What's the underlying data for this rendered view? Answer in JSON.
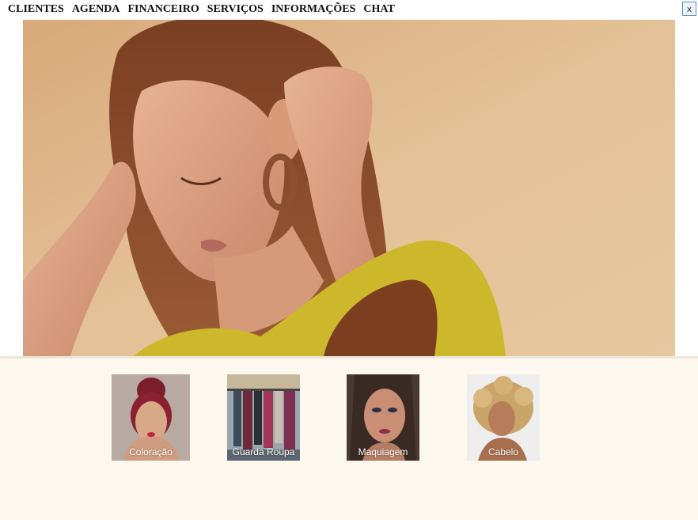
{
  "menu": {
    "items": [
      "CLIENTES",
      "AGENDA",
      "FINANCEIRO",
      "SERVIÇOS",
      "INFORMAÇÕES",
      "CHAT"
    ]
  },
  "close_label": "x",
  "services": [
    {
      "label": "Coloração",
      "image": "woman-red-hair-bun-photo"
    },
    {
      "label": "Guarda Roupa",
      "image": "clothing-rack-photo"
    },
    {
      "label": "Maquiagem",
      "image": "woman-makeup-portrait-photo"
    },
    {
      "label": "Cabelo",
      "image": "woman-curly-blonde-hair-photo"
    }
  ],
  "colors": {
    "background": "#fdf8ee",
    "hero_background": "#dfb98a",
    "hair": "#8a4a26",
    "top": "#cdb82c"
  }
}
